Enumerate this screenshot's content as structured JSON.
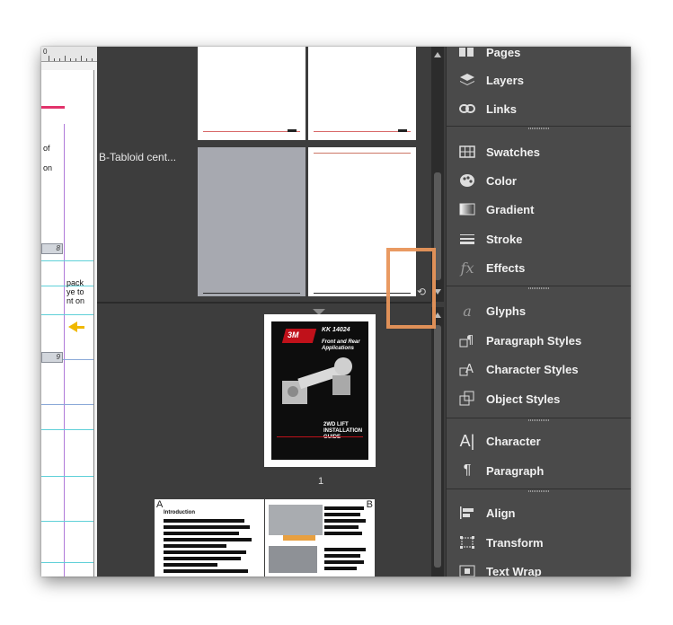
{
  "ruler": {
    "label": "0"
  },
  "document": {
    "text_fragments": [
      "of",
      "on",
      "pack",
      "ye to",
      "nt on"
    ],
    "page_tabs": [
      "8",
      "9"
    ]
  },
  "pages_panel": {
    "master_label": "B-Tabloid cent...",
    "page_number": "1",
    "cover": {
      "title": "KK 14024",
      "subtitle": "Front and Rear Applications",
      "bottom_text": "2WD LIFT INSTALLATION GUIDE",
      "logo": "3M"
    },
    "spread_letters": [
      "A",
      "B"
    ],
    "spread_heading": "Introduction"
  },
  "dock": {
    "groups": [
      [
        {
          "label": "Pages",
          "icon": "pages-icon"
        },
        {
          "label": "Layers",
          "icon": "layers-icon"
        },
        {
          "label": "Links",
          "icon": "links-icon"
        }
      ],
      [
        {
          "label": "Swatches",
          "icon": "swatches-icon"
        },
        {
          "label": "Color",
          "icon": "color-icon"
        },
        {
          "label": "Gradient",
          "icon": "gradient-icon"
        },
        {
          "label": "Stroke",
          "icon": "stroke-icon"
        },
        {
          "label": "Effects",
          "icon": "effects-icon"
        }
      ],
      [
        {
          "label": "Glyphs",
          "icon": "glyphs-icon"
        },
        {
          "label": "Paragraph Styles",
          "icon": "paragraph-styles-icon"
        },
        {
          "label": "Character Styles",
          "icon": "character-styles-icon"
        },
        {
          "label": "Object Styles",
          "icon": "object-styles-icon"
        }
      ],
      [
        {
          "label": "Character",
          "icon": "character-icon"
        },
        {
          "label": "Paragraph",
          "icon": "paragraph-icon"
        }
      ],
      [
        {
          "label": "Align",
          "icon": "align-icon"
        },
        {
          "label": "Transform",
          "icon": "transform-icon"
        },
        {
          "label": "Text Wrap",
          "icon": "text-wrap-icon"
        }
      ]
    ]
  },
  "colors": {
    "highlight": "#e8955a",
    "guide_cyan": "#5fd0d8",
    "margin_purple": "#b07ad9",
    "arrow_yellow": "#f0b800",
    "cover_red": "#c0111a"
  }
}
